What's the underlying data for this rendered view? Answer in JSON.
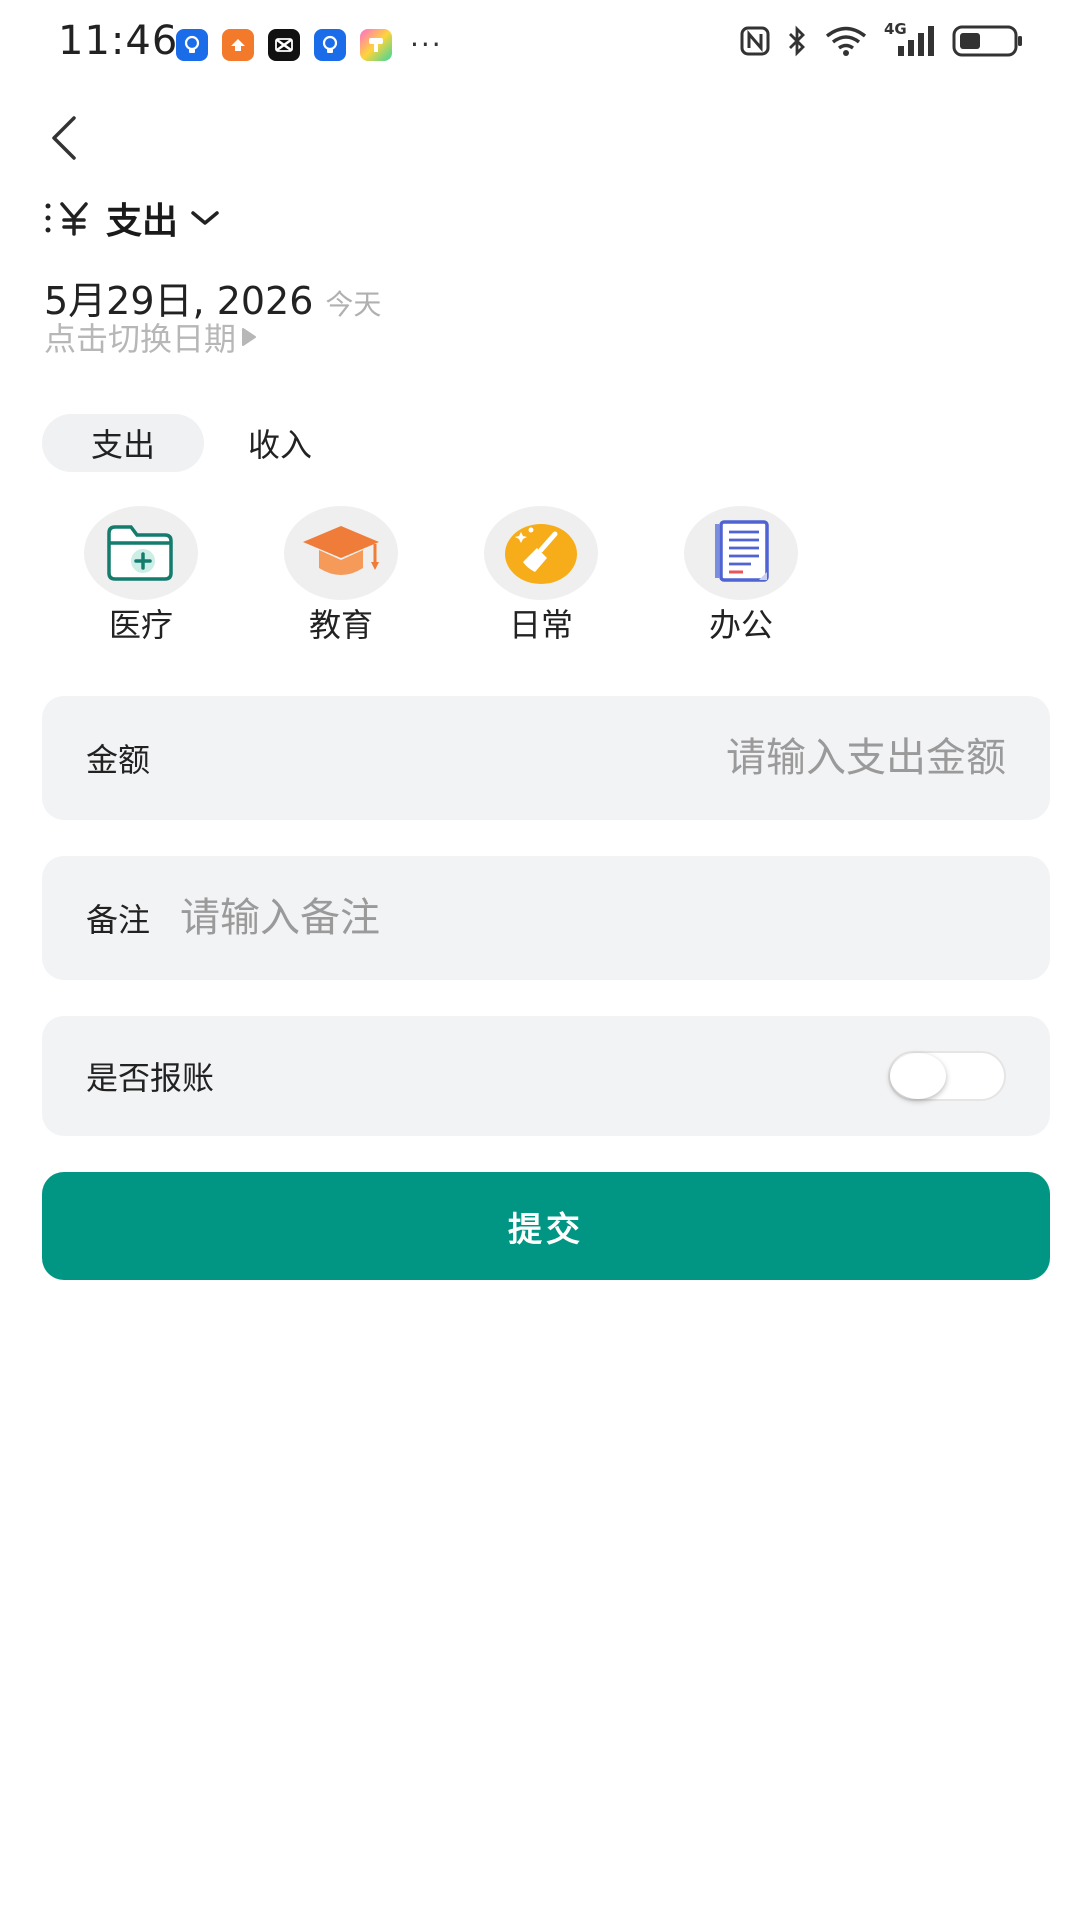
{
  "status_bar": {
    "time": "11:46",
    "more": "···",
    "network": "4G"
  },
  "header": {
    "type_label": "支出"
  },
  "date": {
    "value": "5月29日, 2026",
    "today": "今天",
    "hint": "点击切换日期"
  },
  "tabs": [
    {
      "label": "支出",
      "active": true
    },
    {
      "label": "收入",
      "active": false
    }
  ],
  "categories": [
    {
      "label": "医疗",
      "icon": "medical-folder-icon"
    },
    {
      "label": "教育",
      "icon": "graduation-cap-icon"
    },
    {
      "label": "日常",
      "icon": "broom-icon"
    },
    {
      "label": "办公",
      "icon": "document-icon"
    }
  ],
  "amount": {
    "label": "金额",
    "value": "",
    "placeholder": "请输入支出金额"
  },
  "remark": {
    "label": "备注",
    "value": "",
    "placeholder": "请输入备注"
  },
  "reimburse": {
    "label": "是否报账",
    "on": false
  },
  "submit": {
    "label": "提交"
  },
  "colors": {
    "primary": "#009683",
    "card_bg": "#f2f3f5",
    "placeholder": "#9a9a9a"
  }
}
